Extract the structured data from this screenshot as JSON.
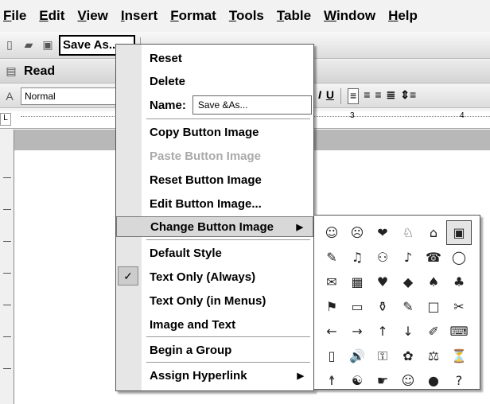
{
  "menubar": {
    "items": [
      "File",
      "Edit",
      "View",
      "Insert",
      "Format",
      "Tools",
      "Table",
      "Window",
      "Help"
    ]
  },
  "toolbar": {
    "save_as_label": "Save As...",
    "icons": [
      "new-icon",
      "open-icon",
      "save-icon"
    ]
  },
  "readbar": {
    "label": "Read"
  },
  "format": {
    "style": "Normal"
  },
  "ruler": {
    "marks": [
      "3",
      "4"
    ]
  },
  "context_menu": {
    "reset": "Reset",
    "delete": "Delete",
    "name_label": "Name:",
    "name_value": "Save &As...",
    "copy_image": "Copy Button Image",
    "paste_image": "Paste Button Image",
    "reset_image": "Reset Button Image",
    "edit_image": "Edit Button Image...",
    "change_image": "Change Button Image",
    "default_style": "Default Style",
    "text_only_always": "Text Only (Always)",
    "text_only_menus": "Text Only (in Menus)",
    "image_and_text": "Image and Text",
    "begin_group": "Begin a Group",
    "assign_hyperlink": "Assign Hyperlink"
  },
  "button_images": [
    "☺",
    "☹",
    "❤",
    "♘",
    "⌂",
    "▣",
    "✎",
    "♫",
    "⚇",
    "♪",
    "☎",
    "◯",
    "✉",
    "▦",
    "♥",
    "◆",
    "♠",
    "♣",
    "⚑",
    "▭",
    "⚱",
    "✎",
    "□",
    "✂",
    "←",
    "→",
    "↑",
    "↓",
    "✐",
    "⌨",
    "▯",
    "🔊",
    "⚿",
    "✿",
    "⚖",
    "⏳",
    "☨",
    "☯",
    "☛",
    "☺",
    "●",
    "?"
  ]
}
